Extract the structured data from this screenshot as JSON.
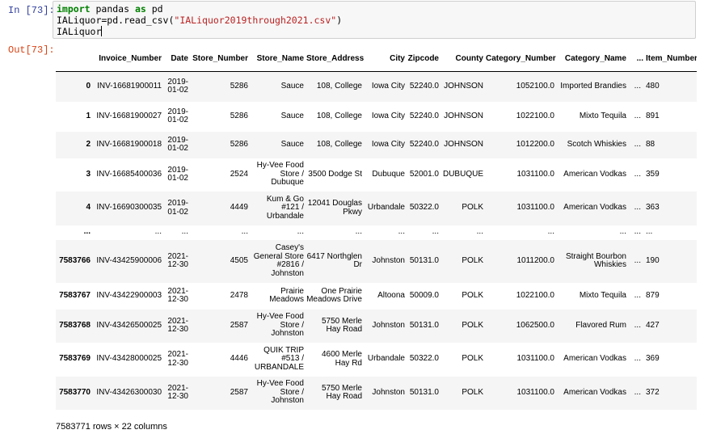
{
  "input_prompt": "In [73]:",
  "output_prompt": "Out[73]:",
  "code": {
    "line1_kw1": "import",
    "line1_mid": " pandas ",
    "line1_kw2": "as",
    "line1_end": " pd",
    "line2_pre": "IALiquor=pd.read_csv(",
    "line2_str": "\"IALiquor2019through2021.csv\"",
    "line2_post": ")",
    "line3": "IALiquor"
  },
  "table": {
    "columns": [
      "",
      "Invoice_Number",
      "Date",
      "Store_Number",
      "Store_Name",
      "Store_Address",
      "City",
      "Zipcode",
      "County",
      "Category_Number",
      "Category_Name",
      "...",
      "Item_Number"
    ],
    "rows": [
      {
        "index": "0",
        "cells": [
          "INV-16681900011",
          "2019-01-02",
          "5286",
          "Sauce",
          "108, College",
          "Iowa City",
          "52240.0",
          "JOHNSON",
          "1052100.0",
          "Imported Brandies",
          "...",
          "480"
        ]
      },
      {
        "index": "1",
        "cells": [
          "INV-16681900027",
          "2019-01-02",
          "5286",
          "Sauce",
          "108, College",
          "Iowa City",
          "52240.0",
          "JOHNSON",
          "1022100.0",
          "Mixto Tequila",
          "...",
          "891"
        ]
      },
      {
        "index": "2",
        "cells": [
          "INV-16681900018",
          "2019-01-02",
          "5286",
          "Sauce",
          "108, College",
          "Iowa City",
          "52240.0",
          "JOHNSON",
          "1012200.0",
          "Scotch Whiskies",
          "...",
          "88"
        ]
      },
      {
        "index": "3",
        "cells": [
          "INV-16685400036",
          "2019-01-02",
          "2524",
          "Hy-Vee Food Store / Dubuque",
          "3500 Dodge St",
          "Dubuque",
          "52001.0",
          "DUBUQUE",
          "1031100.0",
          "American Vodkas",
          "...",
          "359"
        ]
      },
      {
        "index": "4",
        "cells": [
          "INV-16690300035",
          "2019-01-02",
          "4449",
          "Kum & Go #121 / Urbandale",
          "12041 Douglas Pkwy",
          "Urbandale",
          "50322.0",
          "POLK",
          "1031100.0",
          "American Vodkas",
          "...",
          "363"
        ]
      },
      {
        "index": "...",
        "cells": [
          "...",
          "...",
          "...",
          "...",
          "...",
          "...",
          "...",
          "...",
          "...",
          "...",
          "...",
          "..."
        ]
      },
      {
        "index": "7583766",
        "cells": [
          "INV-43425900006",
          "2021-12-30",
          "4505",
          "Casey's General Store #2816 / Johnston",
          "6417 Northglen Dr",
          "Johnston",
          "50131.0",
          "POLK",
          "1011200.0",
          "Straight Bourbon Whiskies",
          "...",
          "190"
        ]
      },
      {
        "index": "7583767",
        "cells": [
          "INV-43422900003",
          "2021-12-30",
          "2478",
          "Prairie Meadows",
          "One Prairie Meadows Drive",
          "Altoona",
          "50009.0",
          "POLK",
          "1022100.0",
          "Mixto Tequila",
          "...",
          "879"
        ]
      },
      {
        "index": "7583768",
        "cells": [
          "INV-43426500025",
          "2021-12-30",
          "2587",
          "Hy-Vee Food Store / Johnston",
          "5750 Merle Hay Road",
          "Johnston",
          "50131.0",
          "POLK",
          "1062500.0",
          "Flavored Rum",
          "...",
          "427"
        ]
      },
      {
        "index": "7583769",
        "cells": [
          "INV-43428000025",
          "2021-12-30",
          "4446",
          "QUIK TRIP #513 / URBANDALE",
          "4600 Merle Hay Rd",
          "Urbandale",
          "50322.0",
          "POLK",
          "1031100.0",
          "American Vodkas",
          "...",
          "369"
        ]
      },
      {
        "index": "7583770",
        "cells": [
          "INV-43426300030",
          "2021-12-30",
          "2587",
          "Hy-Vee Food Store / Johnston",
          "5750 Merle Hay Road",
          "Johnston",
          "50131.0",
          "POLK",
          "1031100.0",
          "American Vodkas",
          "...",
          "372"
        ]
      }
    ]
  },
  "summary": "7583771 rows × 22 columns"
}
